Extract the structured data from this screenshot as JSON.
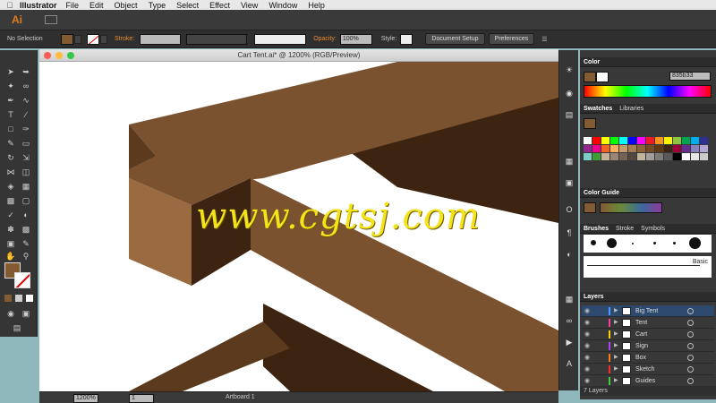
{
  "menubar": {
    "app_name": "Illustrator",
    "items": [
      "File",
      "Edit",
      "Object",
      "Type",
      "Select",
      "Effect",
      "View",
      "Window",
      "Help"
    ]
  },
  "appbar": {
    "logo": "Ai"
  },
  "controlbar": {
    "selection_label": "No Selection",
    "stroke_label": "Stroke:",
    "opacity_label": "Opacity:",
    "opacity_value": "100%",
    "style_label": "Style:",
    "document_setup": "Document Setup",
    "preferences": "Preferences"
  },
  "document": {
    "title": "Cart Tent.ai* @ 1200% (RGB/Preview)",
    "zoom": "1200%",
    "artboard_number": "1",
    "artboard_label": "Artboard 1"
  },
  "watermark": "www.cgtsj.com",
  "colors": {
    "fill": "#835b33",
    "wood_top": "#7a5230",
    "wood_front": "#5b3a1d",
    "wood_side": "#9a6a40",
    "wood_dark": "#3d2410",
    "selection_blue": "#2d4a6e"
  },
  "color_panel": {
    "tab": "Color",
    "hex_value": "835b33"
  },
  "swatches_panel": {
    "tabs": [
      "Swatches",
      "Libraries"
    ]
  },
  "color_guide_panel": {
    "tab": "Color Guide"
  },
  "brushes_panel": {
    "tabs": [
      "Brushes",
      "Stroke",
      "Symbols"
    ],
    "basic_label": "Basic"
  },
  "layers_panel": {
    "tab": "Layers",
    "footer": "7 Layers",
    "layers": [
      {
        "name": "Big Tent",
        "color": "#4a9bff",
        "selected": true
      },
      {
        "name": "Tent",
        "color": "#ff3aa0",
        "selected": false
      },
      {
        "name": "Cart",
        "color": "#ffd100",
        "selected": false
      },
      {
        "name": "Sign",
        "color": "#b040ff",
        "selected": false
      },
      {
        "name": "Box",
        "color": "#ff7a1a",
        "selected": false
      },
      {
        "name": "Sketch",
        "color": "#ff2a2a",
        "selected": false
      },
      {
        "name": "Guides",
        "color": "#3ad13a",
        "selected": false
      }
    ]
  }
}
